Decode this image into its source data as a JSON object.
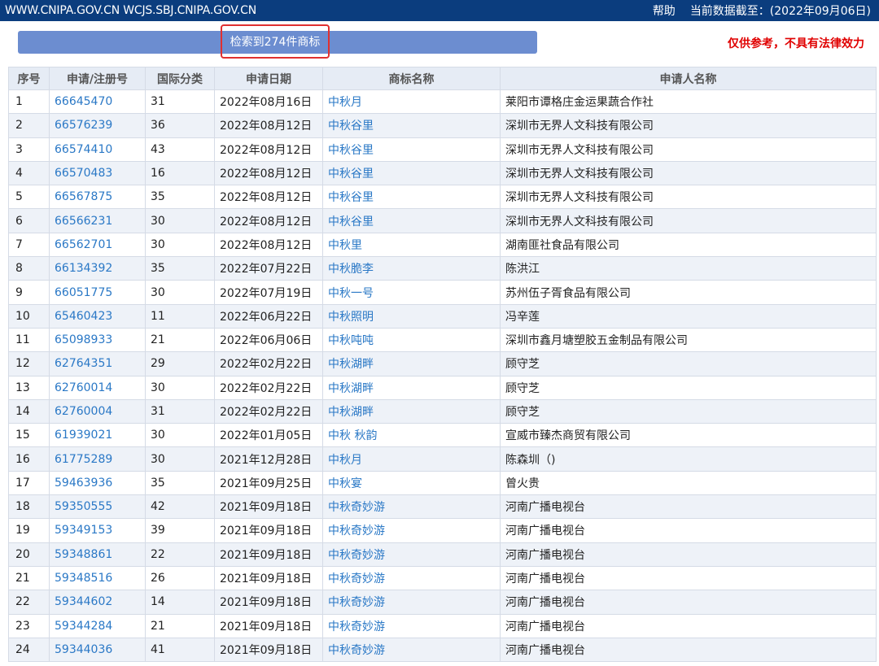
{
  "topbar": {
    "sites": "WWW.CNIPA.GOV.CN WCJS.SBJ.CNIPA.GOV.CN",
    "help": "帮助",
    "data_as_of": "当前数据截至：(2022年09月06日)"
  },
  "banner": {
    "result_count": "检索到274件商标",
    "disclaimer": "仅供参考，不具有法律效力"
  },
  "table": {
    "headers": [
      "序号",
      "申请/注册号",
      "国际分类",
      "申请日期",
      "商标名称",
      "申请人名称"
    ],
    "rows": [
      [
        "1",
        "66645470",
        "31",
        "2022年08月16日",
        "中秋月",
        "莱阳市谭格庄金运果蔬合作社"
      ],
      [
        "2",
        "66576239",
        "36",
        "2022年08月12日",
        "中秋谷里",
        "深圳市无界人文科技有限公司"
      ],
      [
        "3",
        "66574410",
        "43",
        "2022年08月12日",
        "中秋谷里",
        "深圳市无界人文科技有限公司"
      ],
      [
        "4",
        "66570483",
        "16",
        "2022年08月12日",
        "中秋谷里",
        "深圳市无界人文科技有限公司"
      ],
      [
        "5",
        "66567875",
        "35",
        "2022年08月12日",
        "中秋谷里",
        "深圳市无界人文科技有限公司"
      ],
      [
        "6",
        "66566231",
        "30",
        "2022年08月12日",
        "中秋谷里",
        "深圳市无界人文科技有限公司"
      ],
      [
        "7",
        "66562701",
        "30",
        "2022年08月12日",
        "中秋里",
        "湖南匪社食品有限公司"
      ],
      [
        "8",
        "66134392",
        "35",
        "2022年07月22日",
        "中秋脆李",
        "陈洪江"
      ],
      [
        "9",
        "66051775",
        "30",
        "2022年07月19日",
        "中秋一号",
        "苏州伍子胥食品有限公司"
      ],
      [
        "10",
        "65460423",
        "11",
        "2022年06月22日",
        "中秋照明",
        "冯辛莲"
      ],
      [
        "11",
        "65098933",
        "21",
        "2022年06月06日",
        "中秋吨吨",
        "深圳市鑫月塘塑胶五金制品有限公司"
      ],
      [
        "12",
        "62764351",
        "29",
        "2022年02月22日",
        "中秋湖畔",
        "顾守芝"
      ],
      [
        "13",
        "62760014",
        "30",
        "2022年02月22日",
        "中秋湖畔",
        "顾守芝"
      ],
      [
        "14",
        "62760004",
        "31",
        "2022年02月22日",
        "中秋湖畔",
        "顾守芝"
      ],
      [
        "15",
        "61939021",
        "30",
        "2022年01月05日",
        "中秋 秋韵",
        "宣威市臻杰商贸有限公司"
      ],
      [
        "16",
        "61775289",
        "30",
        "2021年12月28日",
        "中秋月",
        "陈森圳（)"
      ],
      [
        "17",
        "59463936",
        "35",
        "2021年09月25日",
        "中秋宴",
        "曾火贵"
      ],
      [
        "18",
        "59350555",
        "42",
        "2021年09月18日",
        "中秋奇妙游",
        "河南广播电视台"
      ],
      [
        "19",
        "59349153",
        "39",
        "2021年09月18日",
        "中秋奇妙游",
        "河南广播电视台"
      ],
      [
        "20",
        "59348861",
        "22",
        "2021年09月18日",
        "中秋奇妙游",
        "河南广播电视台"
      ],
      [
        "21",
        "59348516",
        "26",
        "2021年09月18日",
        "中秋奇妙游",
        "河南广播电视台"
      ],
      [
        "22",
        "59344602",
        "14",
        "2021年09月18日",
        "中秋奇妙游",
        "河南广播电视台"
      ],
      [
        "23",
        "59344284",
        "21",
        "2021年09月18日",
        "中秋奇妙游",
        "河南广播电视台"
      ],
      [
        "24",
        "59344036",
        "41",
        "2021年09月18日",
        "中秋奇妙游",
        "河南广播电视台"
      ]
    ]
  },
  "colors": {
    "topbar_bg": "#0b3d7e",
    "link": "#2a78c6",
    "disclaimer": "#e00000",
    "highlight_border": "#e03030"
  }
}
